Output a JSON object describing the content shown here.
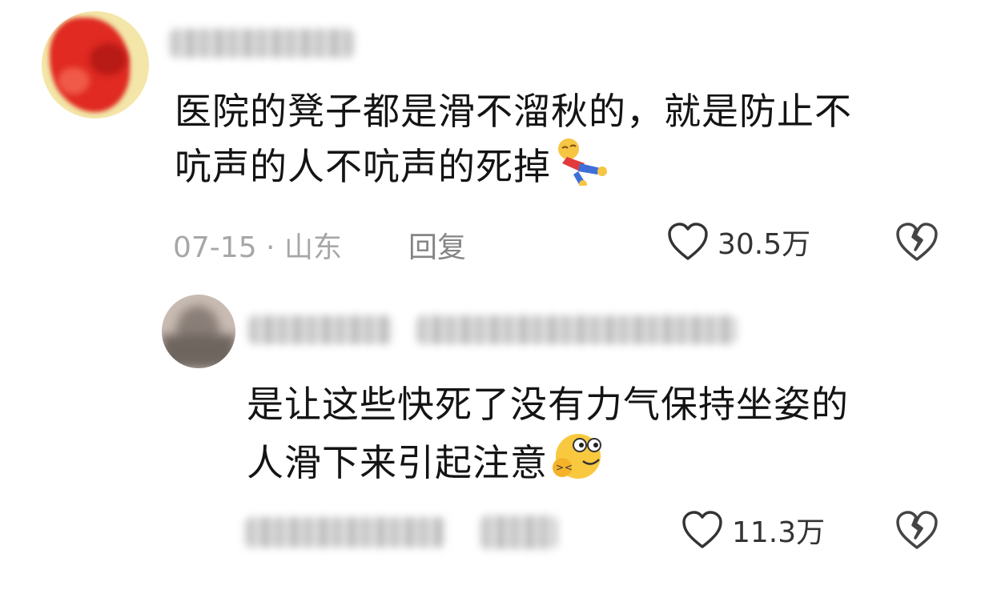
{
  "comment": {
    "text_line1": "医院的凳子都是滑不溜秋的，就是防止不",
    "text_line2": "吭声的人不吭声的死掉",
    "date_location": "07-15 · 山东",
    "reply_label": "回复",
    "likes": "30.5万"
  },
  "reply": {
    "text_line1": "是让这些快死了没有力气保持坐姿的",
    "text_line2": "人滑下来引起注意",
    "likes": "11.3万"
  }
}
